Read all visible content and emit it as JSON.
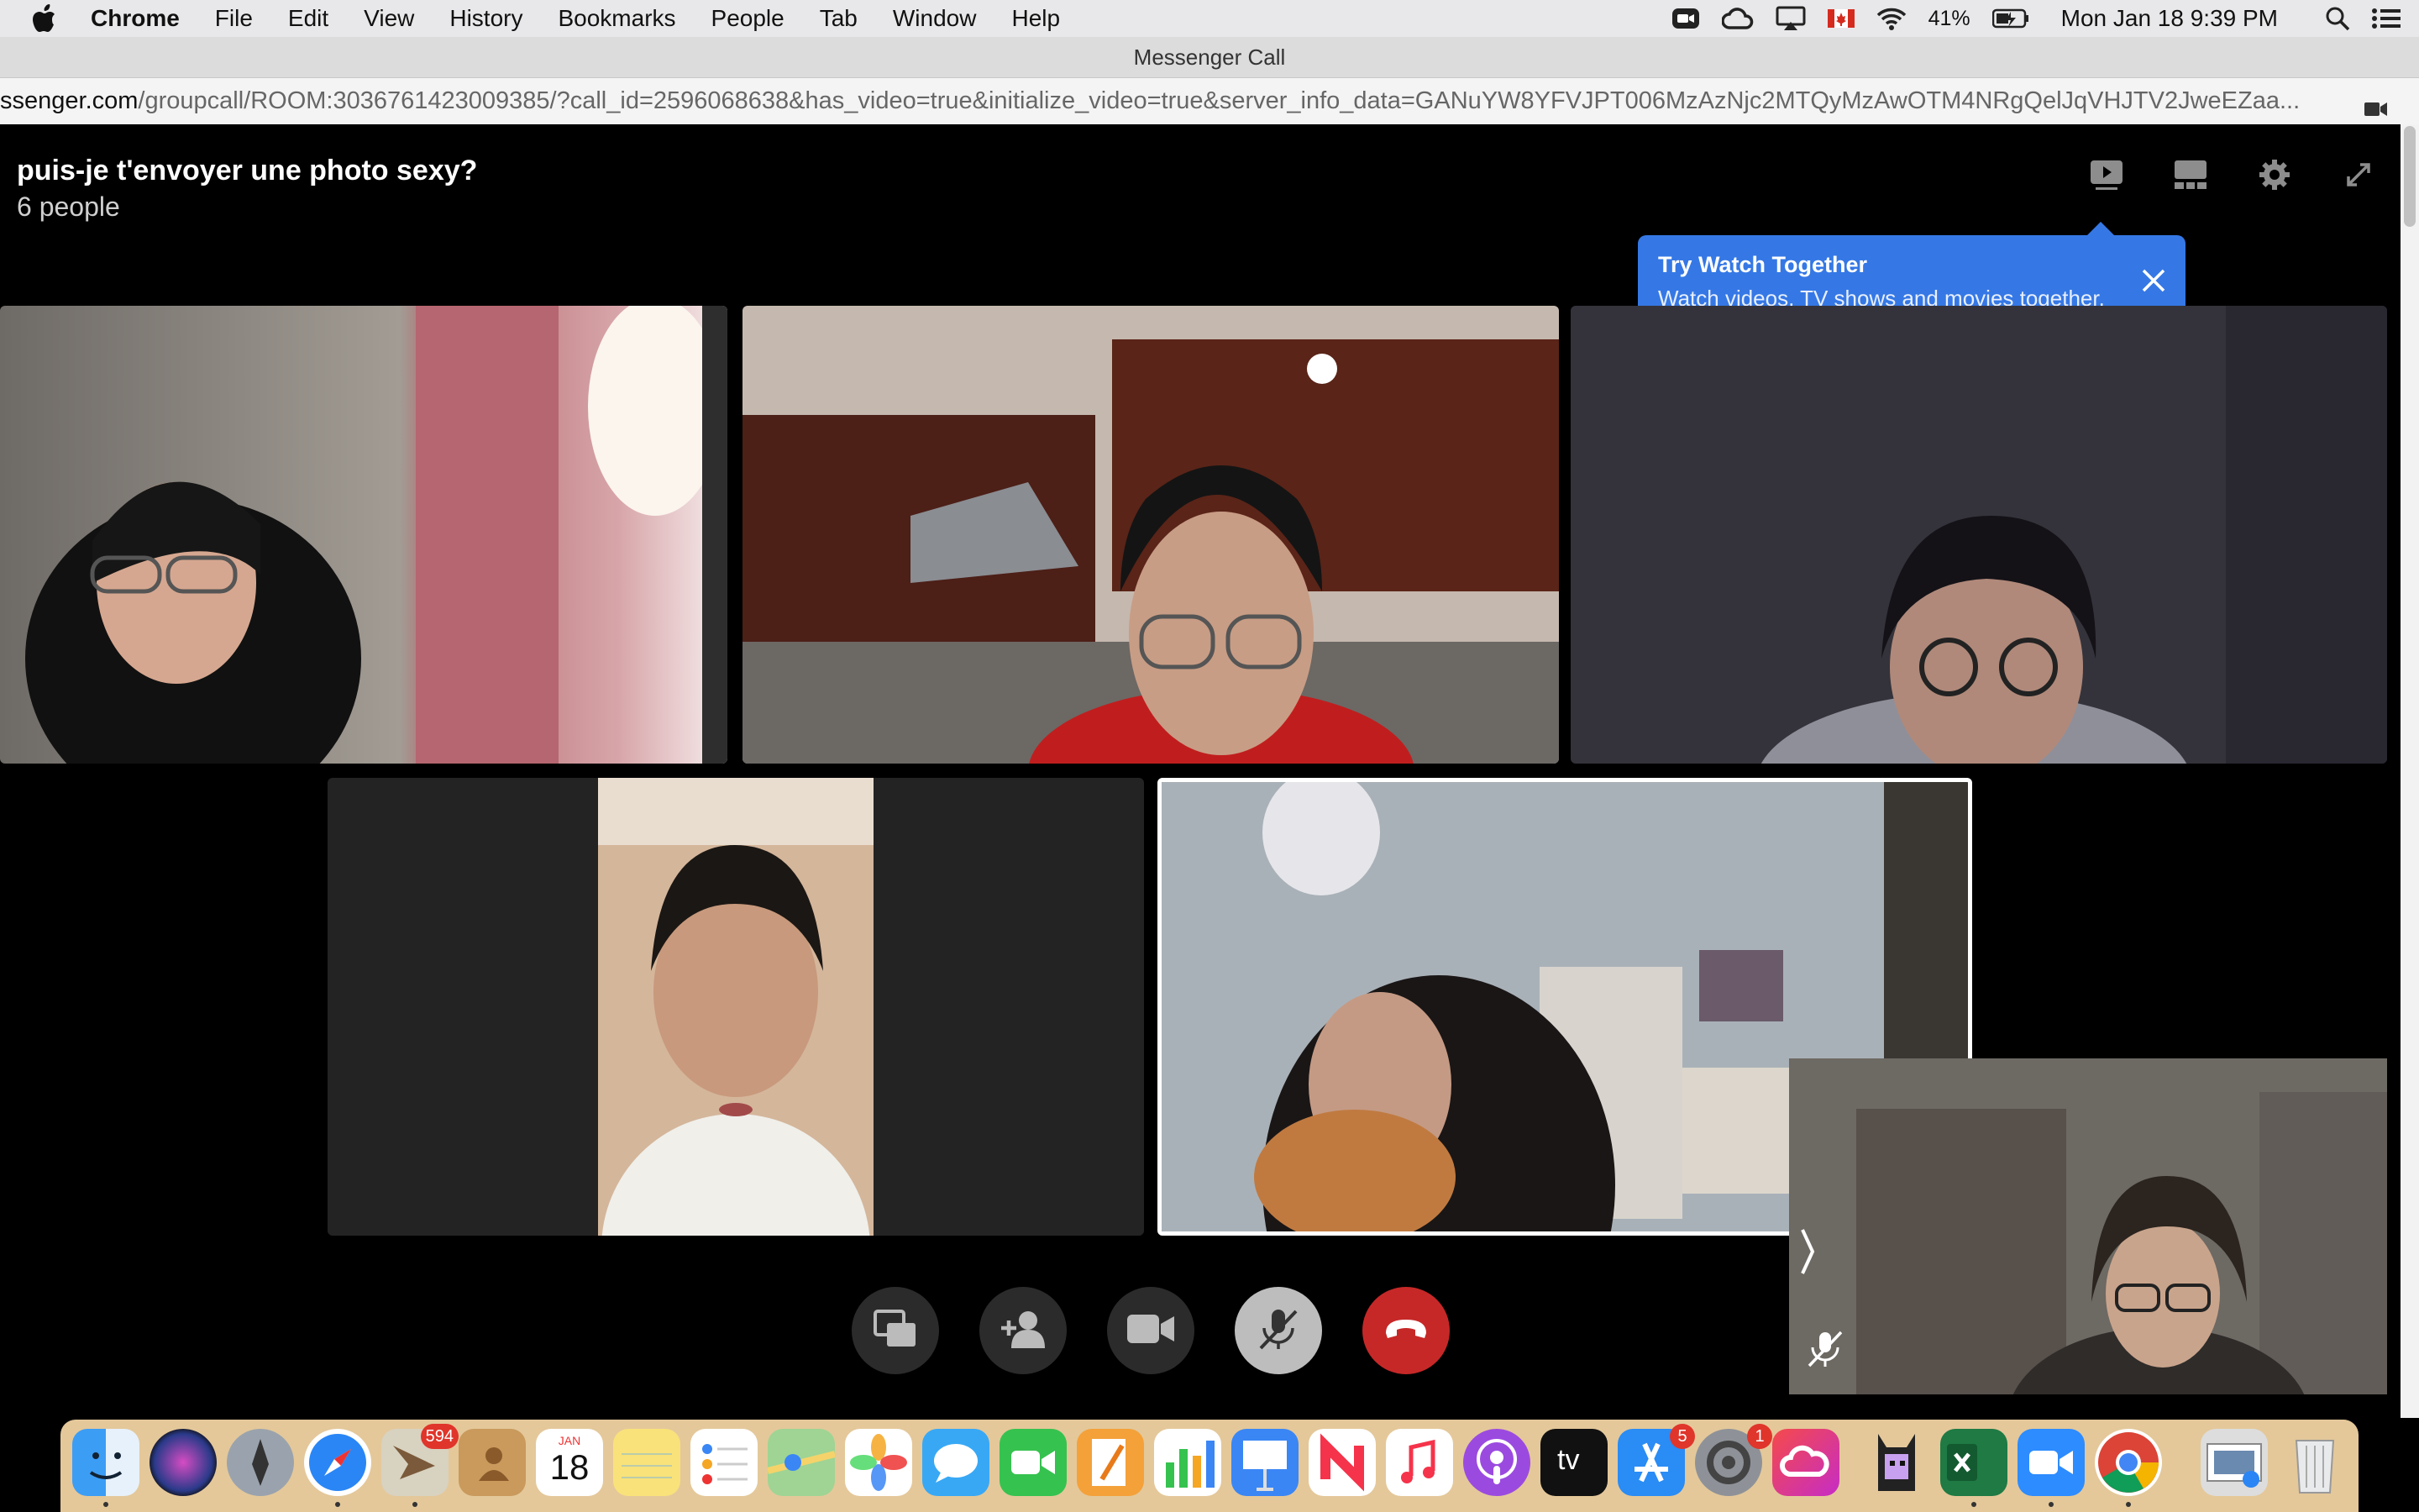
{
  "menubar": {
    "app_name": "Chrome",
    "items": [
      "File",
      "Edit",
      "View",
      "History",
      "Bookmarks",
      "People",
      "Tab",
      "Window",
      "Help"
    ],
    "battery": "41%",
    "datetime": "Mon Jan 18  9:39 PM",
    "status_icons": [
      "zoom-icon",
      "creative-cloud-icon",
      "airplay-icon",
      "canada-flag-icon",
      "wifi-icon",
      "battery-icon",
      "spotlight-icon",
      "notification-center-icon"
    ]
  },
  "window": {
    "title": "Messenger Call",
    "url_host": "ssenger.com",
    "url_path": "/groupcall/ROOM:3036761423009385/?call_id=2596068638&has_video=true&initialize_video=true&server_info_data=GANuYW8YFVJPT006MzAzNjc2MTQyMzAwOTM4NRgQelJqVHJTV2JweEZaa..."
  },
  "call": {
    "title": "puis-je t'envoyer une photo sexy?",
    "participants": "6 people",
    "top_icons": [
      "watch-together-icon",
      "layout-icon",
      "settings-icon",
      "fullscreen-icon"
    ],
    "tooltip": {
      "title": "Try Watch Together",
      "body": "Watch videos, TV shows and movies together."
    },
    "controls": [
      "share-screen-icon",
      "add-person-icon",
      "camera-icon",
      "mute-mic-icon",
      "end-call-icon"
    ],
    "colors": {
      "tooltip": "#3578e5",
      "end_call": "#c62828",
      "control_bg": "#2b2b2b",
      "mute_bg": "#bdbdbd"
    }
  },
  "dock": {
    "apps": [
      {
        "name": "finder-icon",
        "badge": ""
      },
      {
        "name": "siri-icon",
        "badge": ""
      },
      {
        "name": "launchpad-icon",
        "badge": ""
      },
      {
        "name": "safari-icon",
        "badge": ""
      },
      {
        "name": "mail-icon",
        "badge": "594"
      },
      {
        "name": "contacts-icon",
        "badge": ""
      },
      {
        "name": "calendar-icon",
        "badge": "",
        "label_month": "JAN",
        "label_day": "18"
      },
      {
        "name": "notes-icon",
        "badge": ""
      },
      {
        "name": "reminders-icon",
        "badge": ""
      },
      {
        "name": "maps-icon",
        "badge": ""
      },
      {
        "name": "photos-icon",
        "badge": ""
      },
      {
        "name": "messages-icon",
        "badge": ""
      },
      {
        "name": "facetime-icon",
        "badge": ""
      },
      {
        "name": "pages-icon",
        "badge": ""
      },
      {
        "name": "numbers-icon",
        "badge": ""
      },
      {
        "name": "keynote-icon",
        "badge": ""
      },
      {
        "name": "news-icon",
        "badge": ""
      },
      {
        "name": "music-icon",
        "badge": ""
      },
      {
        "name": "podcasts-icon",
        "badge": ""
      },
      {
        "name": "apple-tv-icon",
        "badge": "",
        "label": "tv"
      },
      {
        "name": "app-store-icon",
        "badge": "5"
      },
      {
        "name": "system-preferences-icon",
        "badge": "1"
      },
      {
        "name": "creative-cloud-icon",
        "badge": ""
      },
      {
        "name": "game-app-icon",
        "badge": ""
      },
      {
        "name": "excel-icon",
        "badge": ""
      },
      {
        "name": "zoom-icon",
        "badge": ""
      },
      {
        "name": "chrome-icon",
        "badge": ""
      },
      {
        "name": "preview-icon",
        "badge": ""
      },
      {
        "name": "trash-icon",
        "badge": ""
      }
    ]
  }
}
